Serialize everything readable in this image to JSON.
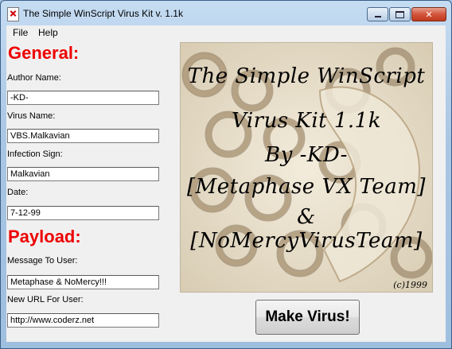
{
  "window": {
    "title": "The Simple WinScript Virus Kit v. 1.1k",
    "minimize_glyph": "",
    "close_glyph": "✕"
  },
  "menu": [
    "File",
    "Help"
  ],
  "general": {
    "heading": "General:",
    "author_label": "Author Name:",
    "author_value": "-KD-",
    "virus_label": "Virus Name:",
    "virus_value": "VBS.Malkavian",
    "sign_label": "Infection Sign:",
    "sign_value": "Malkavian",
    "date_label": "Date:",
    "date_value": "7-12-99"
  },
  "payload": {
    "heading": "Payload:",
    "message_label": "Message To User:",
    "message_value": "Metaphase & NoMercy!!!",
    "url_label": "New URL For User:",
    "url_value": "http://www.coderz.net"
  },
  "picture": {
    "lines": [
      "The Simple WinScript",
      "Virus Kit 1.1k",
      "By -KD-",
      "[Metaphase VX Team]",
      "&",
      "[NoMercyVirusTeam]"
    ],
    "copyright": "(c)1999"
  },
  "make_button": "Make Virus!"
}
